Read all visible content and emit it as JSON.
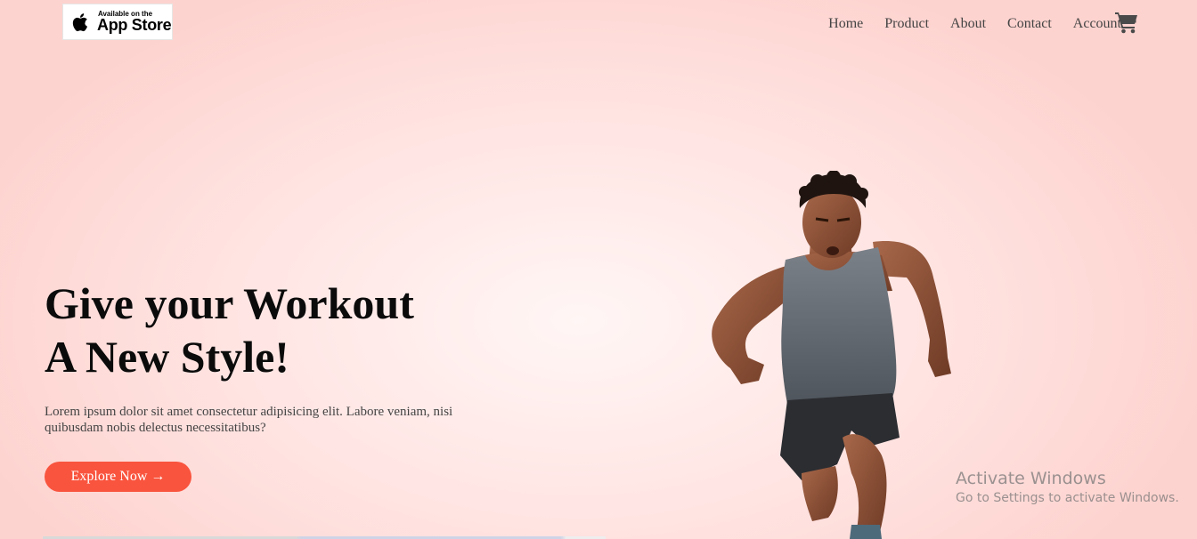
{
  "header": {
    "badge": {
      "small_text": "Available on the",
      "big_text": "App Store"
    },
    "nav": [
      {
        "label": "Home"
      },
      {
        "label": "Product"
      },
      {
        "label": "About"
      },
      {
        "label": "Contact"
      },
      {
        "label": "Account"
      }
    ],
    "cart_icon": "cart-icon"
  },
  "hero": {
    "title_line1": "Give your Workout",
    "title_line2": "A New Style!",
    "text": "Lorem ipsum dolor sit amet consectetur adipisicing elit. Labore veniam, nisi quibusdam nobis delectus necessitatibus?",
    "cta_label": "Explore Now →"
  },
  "watermark": {
    "title": "Activate Windows",
    "subtitle": "Go to Settings to activate Windows."
  },
  "colors": {
    "accent": "#f9543e",
    "background": "#fdd3cf",
    "nav_text": "#444444"
  }
}
